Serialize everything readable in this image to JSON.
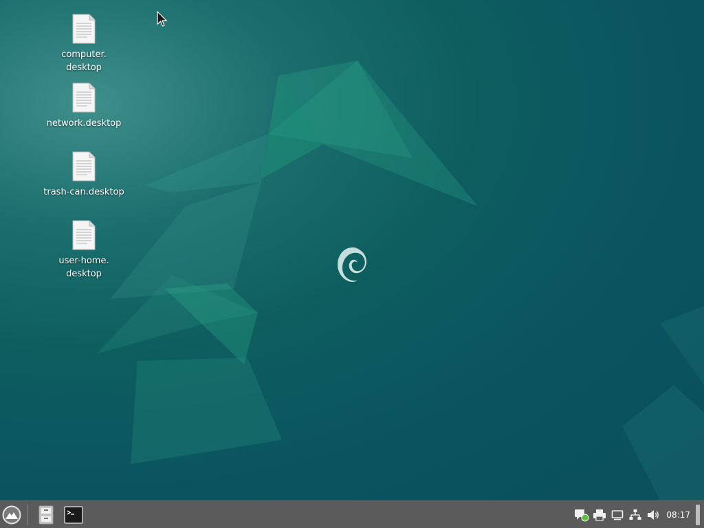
{
  "desktop": {
    "icons": [
      {
        "label": "computer.\ndesktop",
        "icon": "text-file-icon"
      },
      {
        "label": "network.desktop",
        "icon": "text-file-icon"
      },
      {
        "label": "trash-can.desktop",
        "icon": "text-file-icon"
      },
      {
        "label": "user-home.\ndesktop",
        "icon": "text-file-icon"
      }
    ],
    "wallpaper": "debian-teal-swirl",
    "colors": {
      "background": "#0a5460",
      "accent": "#1f8f7f"
    }
  },
  "taskbar": {
    "launchers": [
      {
        "name": "app-menu",
        "icon": "mountain-logo-icon"
      },
      {
        "name": "file-manager",
        "icon": "file-cabinet-icon"
      },
      {
        "name": "terminal",
        "icon": "terminal-icon"
      }
    ],
    "tray": [
      {
        "name": "notifications",
        "icon": "chat-notification-icon"
      },
      {
        "name": "printer",
        "icon": "printer-icon"
      },
      {
        "name": "display",
        "icon": "monitor-icon"
      },
      {
        "name": "network",
        "icon": "network-icon"
      },
      {
        "name": "volume",
        "icon": "speaker-icon"
      }
    ],
    "clock": "08:17",
    "colors": {
      "background": "#5b5b5b"
    }
  }
}
